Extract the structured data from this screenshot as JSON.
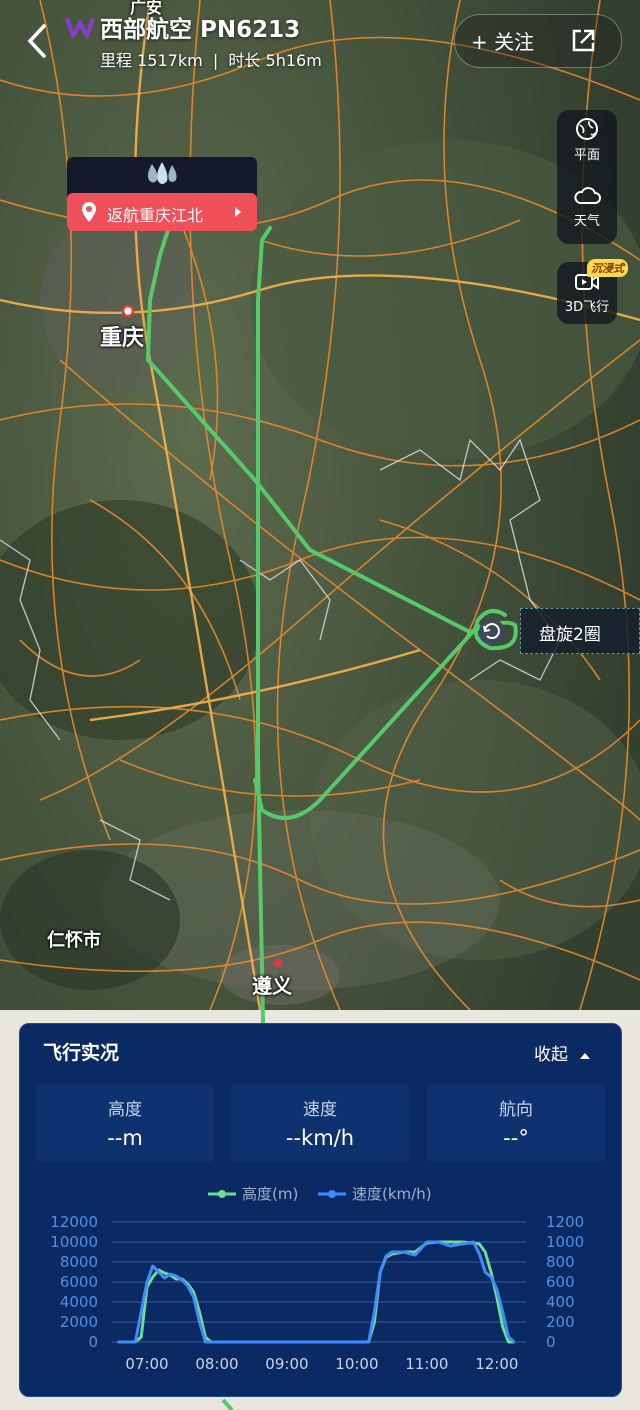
{
  "header": {
    "airline_flight": "西部航空 PN6213",
    "distance_label": "里程",
    "distance_value": "1517km",
    "duration_label": "时长",
    "duration_value": "5h16m",
    "follow_label": "+ 关注"
  },
  "map": {
    "status_tag": "返航重庆江北",
    "holding_label": "盘旋2圈",
    "cities": {
      "chongqing": "重庆",
      "zunyi": "遵义",
      "renhuai": "仁怀市",
      "top_partial": "广安"
    },
    "route_color": "#56c96a"
  },
  "tools": {
    "flat_label": "平面",
    "weather_label": "天气",
    "fly3d_label": "3D飞行",
    "immersive_badge": "沉浸式"
  },
  "panel": {
    "title": "飞行实况",
    "collapse_label": "收起",
    "stats": [
      {
        "label": "高度",
        "value": "--m"
      },
      {
        "label": "速度",
        "value": "--km/h"
      },
      {
        "label": "航向",
        "value": "--°"
      }
    ]
  },
  "chart_data": {
    "type": "line",
    "legend_position": "top",
    "x": [
      "06:35",
      "06:45",
      "06:50",
      "06:55",
      "07:00",
      "07:05",
      "07:10",
      "07:15",
      "07:20",
      "07:25",
      "07:30",
      "07:35",
      "07:40",
      "07:45",
      "07:50",
      "07:55",
      "08:00",
      "08:10",
      "08:30",
      "09:00",
      "09:30",
      "10:00",
      "10:10",
      "10:15",
      "10:20",
      "10:25",
      "10:30",
      "10:40",
      "10:50",
      "11:00",
      "11:10",
      "11:20",
      "11:30",
      "11:40",
      "11:45",
      "11:50",
      "11:55",
      "12:00",
      "12:05",
      "12:10",
      "12:15"
    ],
    "xticks": [
      "07:00",
      "08:00",
      "09:00",
      "10:00",
      "11:00",
      "12:00"
    ],
    "series": [
      {
        "name": "高度(m)",
        "axis": "left",
        "color": "#6be08a",
        "values": [
          0,
          0,
          0,
          500,
          5500,
          6500,
          7200,
          6900,
          6700,
          6300,
          6300,
          5800,
          5000,
          3000,
          500,
          0,
          0,
          0,
          0,
          0,
          0,
          0,
          0,
          2000,
          7000,
          8500,
          8800,
          9000,
          9000,
          9900,
          10000,
          10000,
          10000,
          9900,
          9800,
          9000,
          7000,
          4500,
          1500,
          0,
          0
        ]
      },
      {
        "name": "速度(km/h)",
        "axis": "right",
        "color": "#3f8cff",
        "values": [
          0,
          0,
          0,
          300,
          600,
          760,
          700,
          640,
          680,
          660,
          620,
          560,
          450,
          200,
          0,
          0,
          0,
          0,
          0,
          0,
          0,
          0,
          0,
          300,
          700,
          860,
          900,
          900,
          870,
          1000,
          1000,
          960,
          980,
          1000,
          880,
          700,
          650,
          530,
          300,
          50,
          0
        ]
      }
    ],
    "ylim_left": [
      0,
      12000
    ],
    "ylim_right": [
      0,
      1200
    ],
    "yticks_left": [
      0,
      2000,
      4000,
      6000,
      8000,
      10000,
      12000
    ],
    "yticks_right": [
      0,
      200,
      400,
      600,
      800,
      1000,
      1200
    ],
    "grid": true
  }
}
